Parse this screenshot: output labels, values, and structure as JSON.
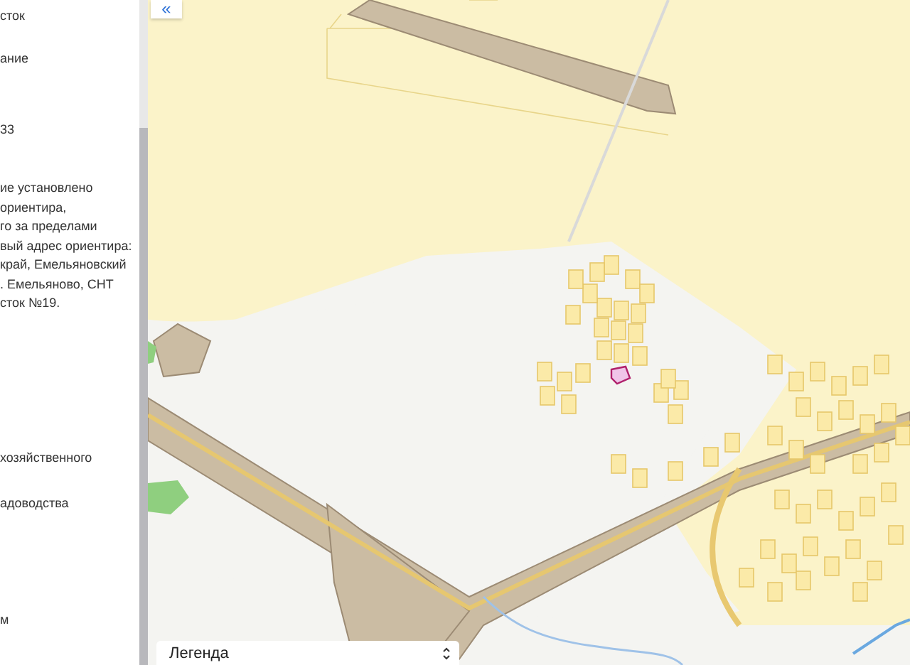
{
  "sidebar": {
    "blocks": [
      {
        "lines": [
          "сток"
        ]
      },
      {
        "lines": [
          "ание"
        ]
      },
      {
        "lines": [
          "33"
        ]
      },
      {
        "lines": [
          "ие установлено",
          "ориентира,",
          "го за пределами",
          "вый адрес ориентира:",
          "край, Емельяновский",
          ". Емельяново, СНТ",
          "сток №19."
        ]
      },
      {
        "lines": [
          "хозяйственного"
        ]
      },
      {
        "lines": [
          "адоводства"
        ]
      },
      {
        "lines": [
          "м"
        ]
      }
    ]
  },
  "map": {
    "collapse_button": "«",
    "legend": {
      "label": "Легенда"
    }
  }
}
